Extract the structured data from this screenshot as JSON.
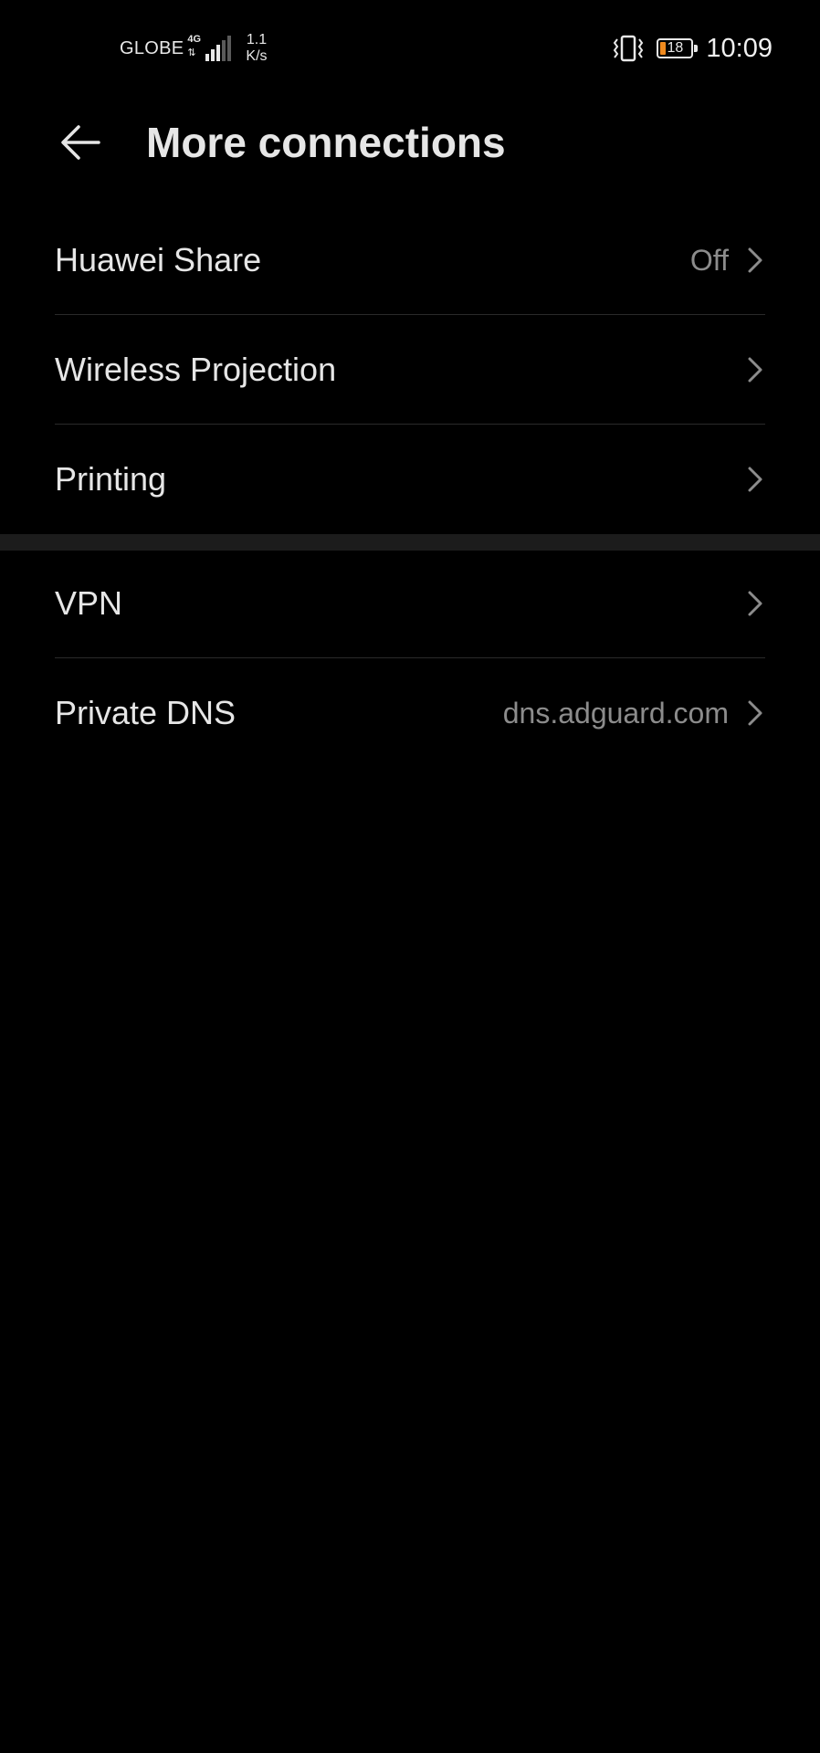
{
  "status_bar": {
    "carrier": "GLOBE",
    "network_type": "4G",
    "signal_bars_filled": 3,
    "signal_bars_total": 5,
    "speed_value": "1.1",
    "speed_unit": "K/s",
    "battery_level": "18",
    "battery_percent": 18,
    "battery_color": "#f08a1e",
    "time": "10:09",
    "icons": [
      "signal-icon",
      "vibrate-icon",
      "battery-icon"
    ]
  },
  "header": {
    "title": "More connections",
    "back_icon": "back-arrow-icon"
  },
  "group_1": [
    {
      "label": "Huawei Share",
      "value": "Off"
    },
    {
      "label": "Wireless Projection",
      "value": ""
    },
    {
      "label": "Printing",
      "value": ""
    }
  ],
  "group_2": [
    {
      "label": "VPN",
      "value": ""
    },
    {
      "label": "Private DNS",
      "value": "dns.adguard.com"
    }
  ],
  "colors": {
    "background": "#000000",
    "text_primary": "#e6e6e6",
    "text_secondary": "#8c8c8c",
    "section_band": "#1c1c1c",
    "separator": "#2a2a2a"
  }
}
